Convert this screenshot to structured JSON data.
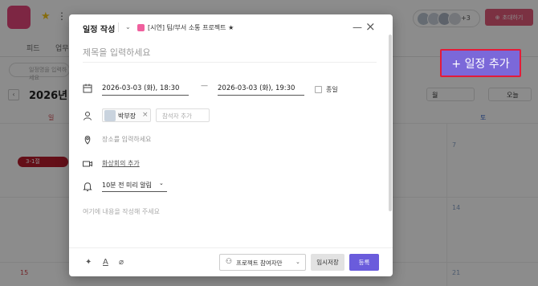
{
  "background": {
    "header": {
      "avatar_count": "+3",
      "invite_label": "초대하기"
    },
    "tabs": [
      "피드",
      "업무"
    ],
    "search_placeholder": "일정명을 입력하세요",
    "year_label": "2026년 3",
    "view_select": "월",
    "today_label": "오늘",
    "weekdays": [
      {
        "label": "일",
        "color": "#d0464e"
      },
      {
        "label": "토",
        "color": "#3e6fd0"
      }
    ],
    "days": [
      "7",
      "14",
      "15",
      "21"
    ],
    "event": "3-1절"
  },
  "modal": {
    "title": "일정 작성",
    "project": "[시연] 팀/부서 소통 프로젝트 ★",
    "project_color": "#f0609e",
    "subject_placeholder": "제목을 입력하세요",
    "start": "2026-03-03 (화), 18:30",
    "dash": "—",
    "end": "2026-03-03 (화), 19:30",
    "all_day": "종일",
    "participant": {
      "name": "박부장"
    },
    "attendee_placeholder": "참석자 추가",
    "place_placeholder": "장소를 입력하세요",
    "video_meeting": "화상회의 추가",
    "alarm": "10분 전 미리 알림",
    "content_placeholder": "여기에 내용을 작성해 주세요",
    "footer": {
      "visibility": "프로젝트 참여자만",
      "temp_save": "임시저장",
      "register": "등록"
    }
  },
  "add_schedule_button": "+ 일정 추가",
  "icons": [
    "calendar-icon",
    "person-icon",
    "pin-icon",
    "video-icon",
    "bell-icon",
    "sparkle-icon",
    "text-icon",
    "attach-icon"
  ]
}
